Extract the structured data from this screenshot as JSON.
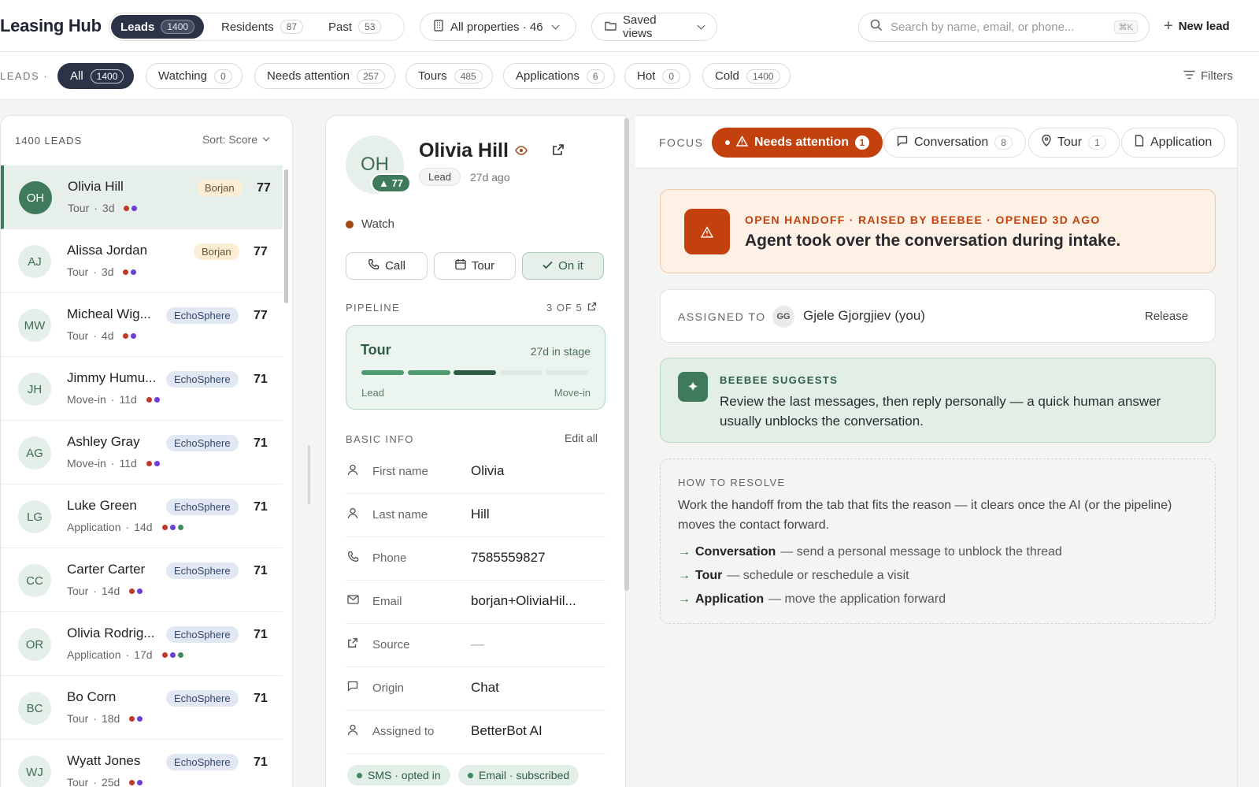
{
  "app": {
    "title": "Leasing Hub"
  },
  "segments": [
    {
      "label": "Leads",
      "count": "1400"
    },
    {
      "label": "Residents",
      "count": "87"
    },
    {
      "label": "Past",
      "count": "53"
    }
  ],
  "properties_dropdown": "All properties · 46",
  "saved_views": "Saved views",
  "search": {
    "placeholder": "Search by name, email, or phone...",
    "shortcut": "⌘K"
  },
  "new_lead": "New lead",
  "filterbar": {
    "label": "LEADS ·",
    "chips": [
      {
        "label": "All",
        "count": "1400"
      },
      {
        "label": "Watching",
        "count": "0"
      },
      {
        "label": "Needs attention",
        "count": "257"
      },
      {
        "label": "Tours",
        "count": "485"
      },
      {
        "label": "Applications",
        "count": "6"
      },
      {
        "label": "Hot",
        "count": "0"
      },
      {
        "label": "Cold",
        "count": "1400"
      }
    ],
    "filters": "Filters"
  },
  "leads": {
    "count_label": "1400 LEADS",
    "sort": "Sort: Score",
    "rows": [
      {
        "initials": "OH",
        "name": "Olivia Hill",
        "stage": "Tour",
        "age": "3d",
        "tag": "Borjan",
        "score": "77"
      },
      {
        "initials": "AJ",
        "name": "Alissa Jordan",
        "stage": "Tour",
        "age": "3d",
        "tag": "Borjan",
        "score": "77"
      },
      {
        "initials": "MW",
        "name": "Micheal Wig...",
        "stage": "Tour",
        "age": "4d",
        "tag": "EchoSphere",
        "score": "77"
      },
      {
        "initials": "JH",
        "name": "Jimmy Humu...",
        "stage": "Move-in",
        "age": "11d",
        "tag": "EchoSphere",
        "score": "71"
      },
      {
        "initials": "AG",
        "name": "Ashley Gray",
        "stage": "Move-in",
        "age": "11d",
        "tag": "EchoSphere",
        "score": "71"
      },
      {
        "initials": "LG",
        "name": "Luke Green",
        "stage": "Application",
        "age": "14d",
        "tag": "EchoSphere",
        "score": "71"
      },
      {
        "initials": "CC",
        "name": "Carter Carter",
        "stage": "Tour",
        "age": "14d",
        "tag": "EchoSphere",
        "score": "71"
      },
      {
        "initials": "OR",
        "name": "Olivia Rodrig...",
        "stage": "Application",
        "age": "17d",
        "tag": "EchoSphere",
        "score": "71"
      },
      {
        "initials": "BC",
        "name": "Bo Corn",
        "stage": "Tour",
        "age": "18d",
        "tag": "EchoSphere",
        "score": "71"
      },
      {
        "initials": "WJ",
        "name": "Wyatt Jones",
        "stage": "Tour",
        "age": "25d",
        "tag": "EchoSphere",
        "score": "71"
      }
    ]
  },
  "detail": {
    "initials": "OH",
    "score": "▲ 77",
    "name": "Olivia Hill",
    "type": "Lead",
    "ago": "27d ago",
    "watch": "Watch",
    "actions": {
      "call": "Call",
      "tour": "Tour",
      "onit": "On it"
    },
    "pipeline": {
      "label": "PIPELINE",
      "position": "3 OF 5",
      "stage": "Tour",
      "days": "27d in stage",
      "start": "Lead",
      "end": "Move-in",
      "current_step": 3,
      "total_steps": 5
    },
    "basic_info": {
      "label": "BASIC INFO",
      "edit": "Edit all",
      "fields": [
        {
          "label": "First name",
          "value": "Olivia"
        },
        {
          "label": "Last name",
          "value": "Hill"
        },
        {
          "label": "Phone",
          "value": "7585559827"
        },
        {
          "label": "Email",
          "value": "borjan+OliviaHil..."
        },
        {
          "label": "Source",
          "value": "—"
        },
        {
          "label": "Origin",
          "value": "Chat"
        },
        {
          "label": "Assigned to",
          "value": "BetterBot AI"
        }
      ]
    },
    "subscriptions": [
      "SMS · opted in",
      "Email · subscribed"
    ]
  },
  "focus": {
    "label": "FOCUS",
    "tabs": [
      {
        "label": "Needs attention",
        "count": "1"
      },
      {
        "label": "Conversation",
        "count": "8"
      },
      {
        "label": "Tour",
        "count": "1"
      },
      {
        "label": "Application",
        "count": ""
      }
    ],
    "handoff": {
      "kicker": "OPEN HANDOFF · RAISED BY BEEBEE · OPENED 3D AGO",
      "title": "Agent took over the conversation during intake."
    },
    "assigned": {
      "label": "ASSIGNED TO",
      "initials": "GG",
      "name": "Gjele Gjorgjiev (you)",
      "release": "Release"
    },
    "suggest": {
      "kicker": "BEEBEE SUGGESTS",
      "text": "Review the last messages, then reply personally — a quick human answer usually unblocks the conversation."
    },
    "resolve": {
      "label": "HOW TO RESOLVE",
      "text": "Work the handoff from the tab that fits the reason — it clears once the AI (or the pipeline) moves the contact forward.",
      "steps": [
        {
          "title": "Conversation",
          "desc": "— send a personal message to unblock the thread"
        },
        {
          "title": "Tour",
          "desc": "— schedule or reschedule a visit"
        },
        {
          "title": "Application",
          "desc": "— move the application forward"
        }
      ]
    }
  },
  "colors": {
    "accent_green": "#3f7a5c",
    "alert_orange": "#c2410c",
    "navy": "#2c3346",
    "dot_red": "#c0392b",
    "dot_purple": "#6b3fd6",
    "dot_green": "#3f8a5c"
  }
}
